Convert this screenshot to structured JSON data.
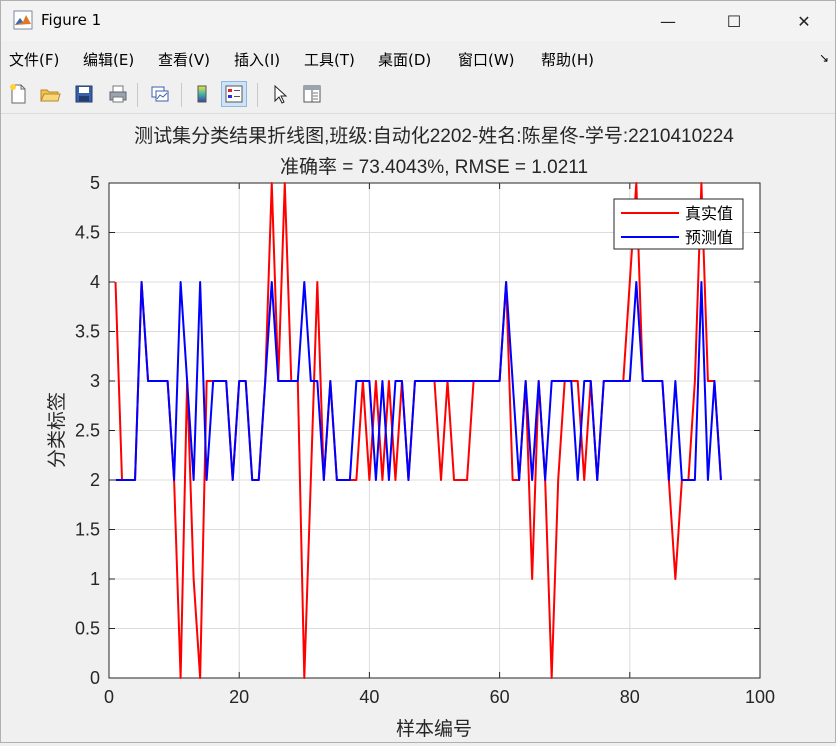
{
  "window": {
    "title": "Figure 1",
    "controls": {
      "minimize": "—",
      "maximize": "☐",
      "close": "✕"
    }
  },
  "menubar": {
    "items": [
      "文件(F)",
      "编辑(E)",
      "查看(V)",
      "插入(I)",
      "工具(T)",
      "桌面(D)",
      "窗口(W)",
      "帮助(H)"
    ],
    "overflow_icon": "↘"
  },
  "toolbar": {
    "icons": [
      "new-figure-icon",
      "open-folder-icon",
      "save-icon",
      "print-icon",
      "link-plot-icon",
      "colorbar-icon",
      "legend-icon",
      "pointer-icon",
      "property-editor-icon"
    ]
  },
  "chart_data": {
    "type": "line",
    "title": "测试集分类结果折线图,班级:自动化2202-姓名:陈星佟-学号:2210410224",
    "subtitle": "准确率 = 73.4043%, RMSE = 1.0211",
    "xlabel": "样本编号",
    "ylabel": "分类标签",
    "xlim": [
      0,
      100
    ],
    "ylim": [
      0,
      5
    ],
    "xticks": [
      0,
      20,
      40,
      60,
      80,
      100
    ],
    "yticks": [
      0,
      0.5,
      1,
      1.5,
      2,
      2.5,
      3,
      3.5,
      4,
      4.5,
      5
    ],
    "xtick_labels": [
      "0",
      "20",
      "40",
      "60",
      "80",
      "100"
    ],
    "ytick_labels": [
      "0",
      "0.5",
      "1",
      "1.5",
      "2",
      "2.5",
      "3",
      "3.5",
      "4",
      "4.5",
      "5"
    ],
    "grid": true,
    "legend": {
      "position": "top-right",
      "entries": [
        "真实值",
        "预测值"
      ]
    },
    "series": [
      {
        "name": "真实值",
        "color": "#ff0000",
        "x": [
          1,
          2,
          3,
          4,
          5,
          6,
          7,
          8,
          9,
          10,
          11,
          12,
          13,
          14,
          15,
          16,
          17,
          18,
          19,
          20,
          21,
          22,
          23,
          24,
          25,
          26,
          27,
          28,
          29,
          30,
          31,
          32,
          33,
          34,
          35,
          36,
          37,
          38,
          39,
          40,
          41,
          42,
          43,
          44,
          45,
          46,
          47,
          48,
          49,
          50,
          51,
          52,
          53,
          54,
          55,
          56,
          57,
          58,
          59,
          60,
          61,
          62,
          63,
          64,
          65,
          66,
          67,
          68,
          69,
          70,
          71,
          72,
          73,
          74,
          75,
          76,
          77,
          78,
          79,
          80,
          81,
          82,
          83,
          84,
          85,
          86,
          87,
          88,
          89,
          90,
          91,
          92,
          93,
          94
        ],
        "y": [
          4,
          2,
          2,
          2,
          4,
          3,
          3,
          3,
          3,
          2,
          0,
          3,
          1,
          0,
          3,
          3,
          3,
          3,
          2,
          3,
          3,
          2,
          2,
          3,
          5,
          3,
          5,
          3,
          3,
          0,
          2,
          4,
          2,
          3,
          2,
          2,
          2,
          2,
          3,
          2,
          3,
          2,
          3,
          2,
          3,
          2,
          3,
          3,
          3,
          3,
          2,
          3,
          2,
          2,
          2,
          3,
          3,
          3,
          3,
          3,
          4,
          2,
          2,
          3,
          1,
          3,
          2,
          0,
          2,
          3,
          3,
          3,
          2,
          3,
          2,
          3,
          3,
          3,
          3,
          4,
          5,
          3,
          3,
          3,
          3,
          2,
          1,
          2,
          2,
          3,
          5,
          3,
          3,
          2
        ]
      },
      {
        "name": "预测值",
        "color": "#0000ff",
        "x": [
          1,
          2,
          3,
          4,
          5,
          6,
          7,
          8,
          9,
          10,
          11,
          12,
          13,
          14,
          15,
          16,
          17,
          18,
          19,
          20,
          21,
          22,
          23,
          24,
          25,
          26,
          27,
          28,
          29,
          30,
          31,
          32,
          33,
          34,
          35,
          36,
          37,
          38,
          39,
          40,
          41,
          42,
          43,
          44,
          45,
          46,
          47,
          48,
          49,
          50,
          51,
          52,
          53,
          54,
          55,
          56,
          57,
          58,
          59,
          60,
          61,
          62,
          63,
          64,
          65,
          66,
          67,
          68,
          69,
          70,
          71,
          72,
          73,
          74,
          75,
          76,
          77,
          78,
          79,
          80,
          81,
          82,
          83,
          84,
          85,
          86,
          87,
          88,
          89,
          90,
          91,
          92,
          93,
          94
        ],
        "y": [
          2,
          2,
          2,
          2,
          4,
          3,
          3,
          3,
          3,
          2,
          4,
          3,
          2,
          4,
          2,
          3,
          3,
          3,
          2,
          3,
          3,
          2,
          2,
          3,
          4,
          3,
          3,
          3,
          3,
          4,
          3,
          3,
          2,
          3,
          2,
          2,
          2,
          3,
          3,
          3,
          2,
          3,
          2,
          3,
          3,
          2,
          3,
          3,
          3,
          3,
          3,
          3,
          3,
          3,
          3,
          3,
          3,
          3,
          3,
          3,
          4,
          3,
          2,
          3,
          2,
          3,
          2,
          3,
          3,
          3,
          3,
          2,
          3,
          3,
          2,
          3,
          3,
          3,
          3,
          3,
          4,
          3,
          3,
          3,
          3,
          2,
          3,
          2,
          2,
          2,
          4,
          2,
          3,
          2
        ]
      }
    ]
  }
}
